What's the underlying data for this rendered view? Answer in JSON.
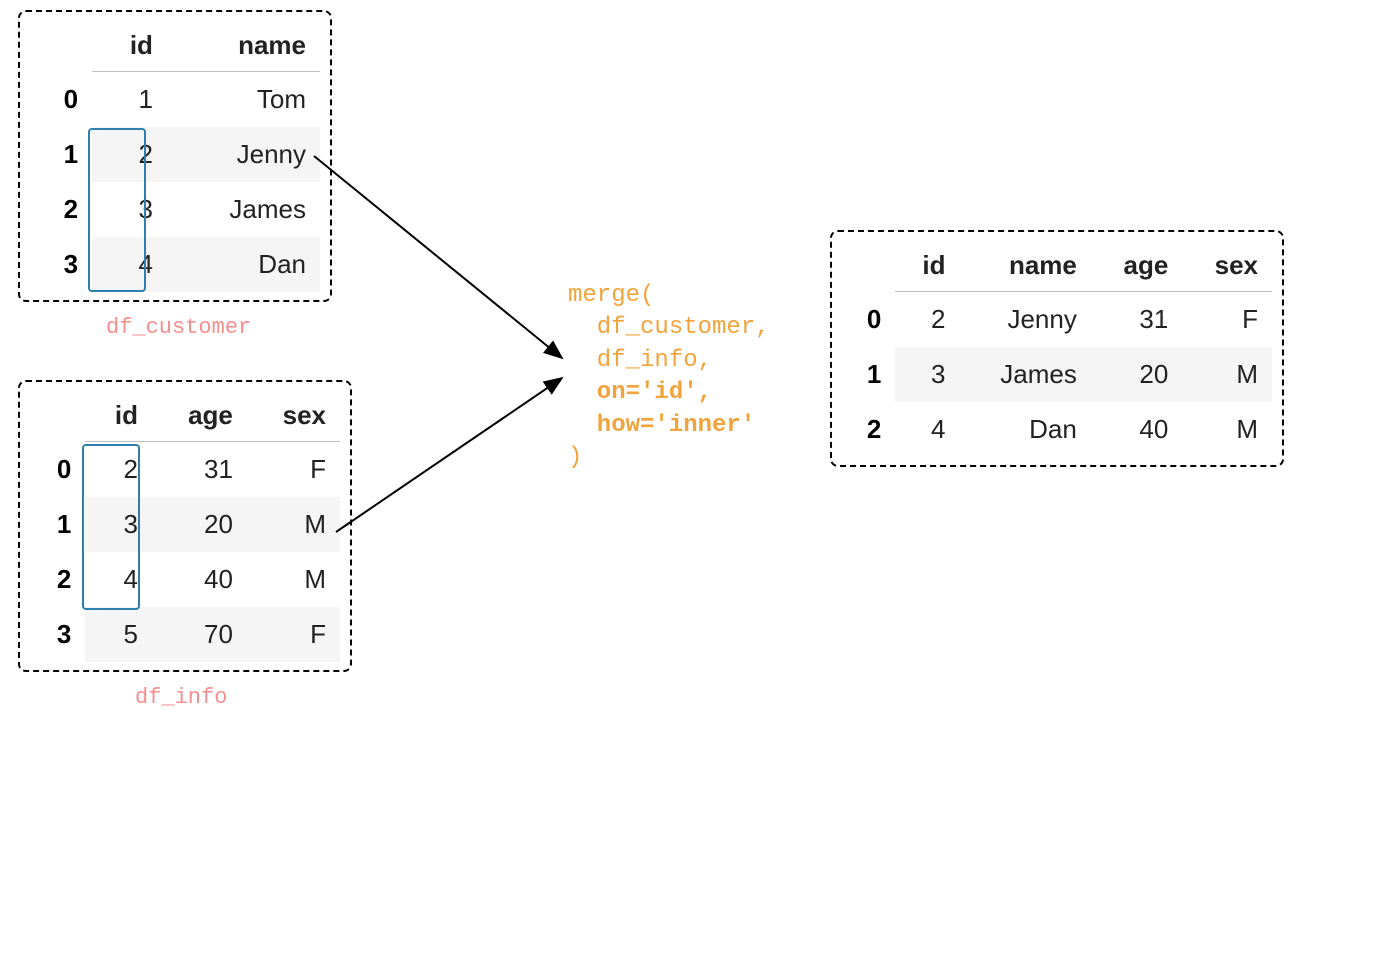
{
  "df_customer": {
    "label": "df_customer",
    "columns": [
      "id",
      "name"
    ],
    "index": [
      "0",
      "1",
      "2",
      "3"
    ],
    "rows": [
      {
        "id": "1",
        "name": "Tom"
      },
      {
        "id": "2",
        "name": "Jenny"
      },
      {
        "id": "3",
        "name": "James"
      },
      {
        "id": "4",
        "name": "Dan"
      }
    ]
  },
  "df_info": {
    "label": "df_info",
    "columns": [
      "id",
      "age",
      "sex"
    ],
    "index": [
      "0",
      "1",
      "2",
      "3"
    ],
    "rows": [
      {
        "id": "2",
        "age": "31",
        "sex": "F"
      },
      {
        "id": "3",
        "age": "20",
        "sex": "M"
      },
      {
        "id": "4",
        "age": "40",
        "sex": "M"
      },
      {
        "id": "5",
        "age": "70",
        "sex": "F"
      }
    ]
  },
  "df_result": {
    "columns": [
      "id",
      "name",
      "age",
      "sex"
    ],
    "index": [
      "0",
      "1",
      "2"
    ],
    "rows": [
      {
        "id": "2",
        "name": "Jenny",
        "age": "31",
        "sex": "F"
      },
      {
        "id": "3",
        "name": "James",
        "age": "20",
        "sex": "M"
      },
      {
        "id": "4",
        "name": "Dan",
        "age": "40",
        "sex": "M"
      }
    ]
  },
  "code": {
    "line1": "merge(",
    "line2": "  df_customer,",
    "line3": "  df_info,",
    "line4": "  on='id',",
    "line5": "  how='inner'",
    "line6": ")"
  }
}
